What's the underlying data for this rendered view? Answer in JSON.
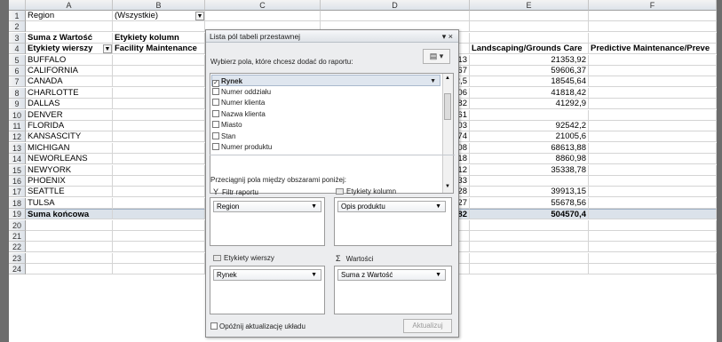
{
  "columns": [
    "A",
    "B",
    "C",
    "D",
    "E",
    "F"
  ],
  "rows": [
    {
      "n": "1",
      "a": "Region",
      "b": "(Wszystkie)",
      "d": "",
      "e": "",
      "f": "",
      "filter": true
    },
    {
      "n": "2",
      "a": "",
      "b": "",
      "d": "",
      "e": "",
      "f": ""
    },
    {
      "n": "3",
      "a": "Suma z Wartość",
      "b": "Etykiety kolumn",
      "d": "",
      "e": "",
      "f": "",
      "bold": true
    },
    {
      "n": "4",
      "a": "Etykiety wierszy",
      "b": "Facility Maintenance",
      "d": "re",
      "e": "Landscaping/Grounds Care",
      "f": "Predictive Maintenance/Preve",
      "bold": true,
      "filterA": true
    },
    {
      "n": "5",
      "a": "BUFFALO",
      "b": "",
      "d": "13",
      "e": "21353,92",
      "f": ""
    },
    {
      "n": "6",
      "a": "CALIFORNIA",
      "b": "",
      "d": "67",
      "e": "59606,37",
      "f": ""
    },
    {
      "n": "7",
      "a": "CANADA",
      "b": "",
      "d": "2,5",
      "e": "18545,64",
      "f": ""
    },
    {
      "n": "8",
      "a": "CHARLOTTE",
      "b": "",
      "d": "06",
      "e": "41818,42",
      "f": ""
    },
    {
      "n": "9",
      "a": "DALLAS",
      "b": "",
      "d": "82",
      "e": "41292,9",
      "f": ""
    },
    {
      "n": "10",
      "a": "DENVER",
      "b": "",
      "d": "61",
      "e": "",
      "f": ""
    },
    {
      "n": "11",
      "a": "FLORIDA",
      "b": "",
      "d": "03",
      "e": "92542,2",
      "f": ""
    },
    {
      "n": "12",
      "a": "KANSASCITY",
      "b": "",
      "d": "74",
      "e": "21005,6",
      "f": ""
    },
    {
      "n": "13",
      "a": "MICHIGAN",
      "b": "",
      "d": "08",
      "e": "68613,88",
      "f": ""
    },
    {
      "n": "14",
      "a": "NEWORLEANS",
      "b": "",
      "d": "18",
      "e": "8860,98",
      "f": ""
    },
    {
      "n": "15",
      "a": "NEWYORK",
      "b": "",
      "d": "12",
      "e": "35338,78",
      "f": ""
    },
    {
      "n": "16",
      "a": "PHOENIX",
      "b": "",
      "d": "33",
      "e": "",
      "f": ""
    },
    {
      "n": "17",
      "a": "SEATTLE",
      "b": "",
      "d": "28",
      "e": "39913,15",
      "f": ""
    },
    {
      "n": "18",
      "a": "TULSA",
      "b": "",
      "d": "27",
      "e": "55678,56",
      "f": ""
    },
    {
      "n": "19",
      "a": "Suma końcowa",
      "b": "",
      "d": "82",
      "e": "504570,4",
      "f": "",
      "bold": true,
      "total": true
    },
    {
      "n": "20",
      "a": "",
      "b": "",
      "d": "",
      "e": "",
      "f": ""
    },
    {
      "n": "21",
      "a": "",
      "b": "",
      "d": "",
      "e": "",
      "f": ""
    },
    {
      "n": "22",
      "a": "",
      "b": "",
      "d": "",
      "e": "",
      "f": ""
    },
    {
      "n": "23",
      "a": "",
      "b": "",
      "d": "",
      "e": "",
      "f": ""
    },
    {
      "n": "24",
      "a": "",
      "b": "",
      "d": "",
      "e": "",
      "f": ""
    }
  ],
  "panel": {
    "title": "Lista pól tabeli przestawnej",
    "close": "▾ ×",
    "choose_label": "Wybierz pola, które chcesz dodać do raportu:",
    "fields": [
      {
        "label": "Rynek",
        "checked": true,
        "bold": true
      },
      {
        "label": "Numer oddziału",
        "checked": false
      },
      {
        "label": "Numer klienta",
        "checked": false
      },
      {
        "label": "Nazwa klienta",
        "checked": false
      },
      {
        "label": "Miasto",
        "checked": false
      },
      {
        "label": "Stan",
        "checked": false
      },
      {
        "label": "Numer produktu",
        "checked": false
      }
    ],
    "drag_label": "Przeciągnij pola między obszarami poniżej:",
    "filter_head": "Filtr raportu",
    "columns_head": "Etykiety kolumn",
    "rows_head": "Etykiety wierszy",
    "values_head": "Wartości",
    "filter_chip": "Region",
    "columns_chip": "Opis produktu",
    "rows_chip": "Rynek",
    "values_chip": "Suma z Wartość",
    "defer_label": "Opóźnij aktualizację układu",
    "update_label": "Aktualizuj"
  }
}
